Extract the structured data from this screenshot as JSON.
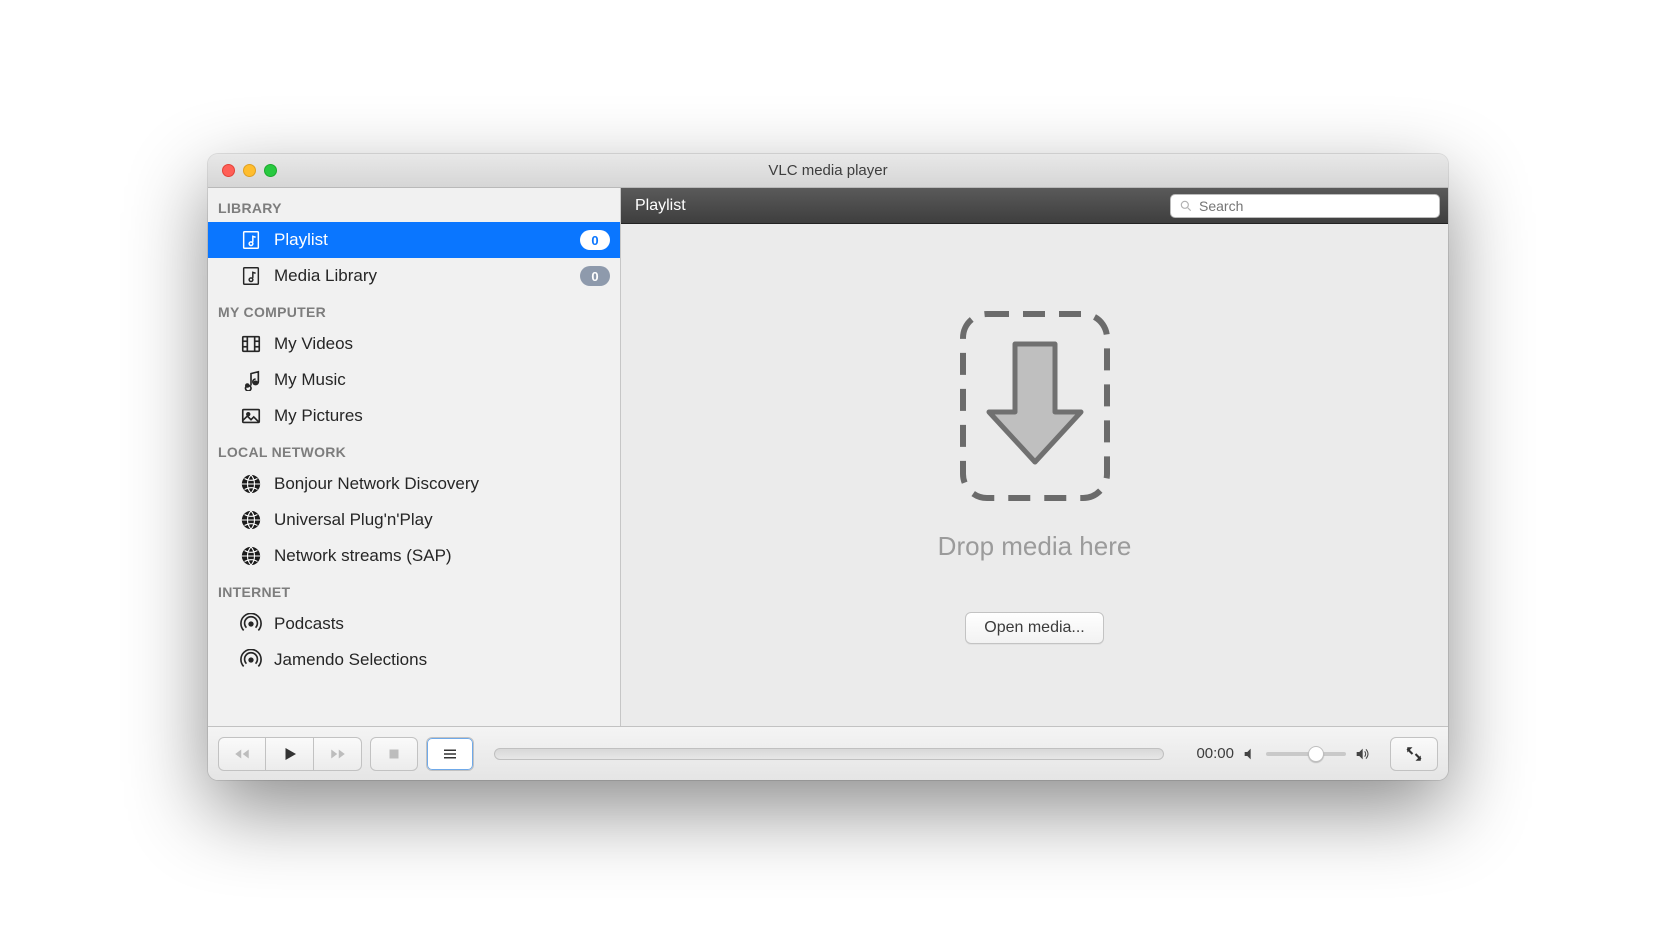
{
  "window": {
    "title": "VLC media player"
  },
  "sidebar": {
    "sections": [
      {
        "header": "LIBRARY",
        "items": [
          {
            "label": "Playlist",
            "badge": "0",
            "selected": true,
            "icon": "playlist"
          },
          {
            "label": "Media Library",
            "badge": "0",
            "selected": false,
            "icon": "playlist"
          }
        ]
      },
      {
        "header": "MY COMPUTER",
        "items": [
          {
            "label": "My Videos",
            "icon": "film"
          },
          {
            "label": "My Music",
            "icon": "music"
          },
          {
            "label": "My Pictures",
            "icon": "picture"
          }
        ]
      },
      {
        "header": "LOCAL NETWORK",
        "items": [
          {
            "label": "Bonjour Network Discovery",
            "icon": "globe"
          },
          {
            "label": "Universal Plug'n'Play",
            "icon": "globe"
          },
          {
            "label": "Network streams (SAP)",
            "icon": "globe"
          }
        ]
      },
      {
        "header": "INTERNET",
        "items": [
          {
            "label": "Podcasts",
            "icon": "podcast"
          },
          {
            "label": "Jamendo Selections",
            "icon": "podcast"
          }
        ]
      }
    ]
  },
  "content": {
    "header_title": "Playlist",
    "search_placeholder": "Search",
    "dropzone_text": "Drop media here",
    "open_button_label": "Open media..."
  },
  "controls": {
    "time": "00:00"
  }
}
